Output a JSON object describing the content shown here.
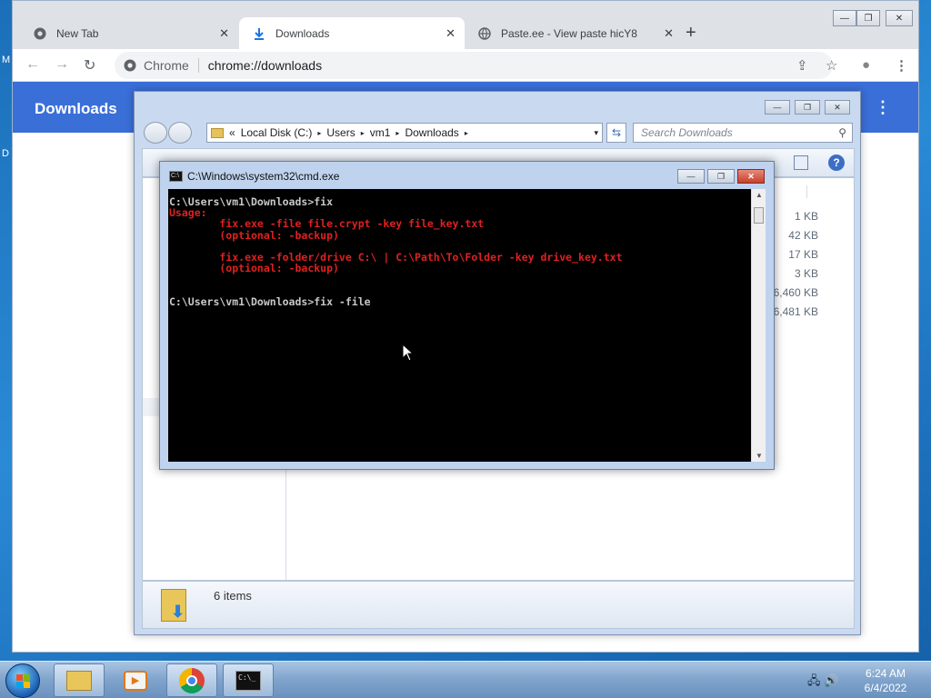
{
  "desktop": {
    "stub_top": "M",
    "stub_mid": "D"
  },
  "chrome": {
    "tabs": [
      {
        "title": "New Tab",
        "icon": "chrome-icon",
        "close": "✕"
      },
      {
        "title": "Downloads",
        "icon": "download-icon",
        "close": "✕"
      },
      {
        "title": "Paste.ee - View paste hicY8",
        "icon": "globe-icon",
        "close": "✕"
      }
    ],
    "new_tab": "+",
    "window_controls": {
      "minimize": "—",
      "restore": "❐",
      "close": "✕"
    },
    "nav": {
      "back": "←",
      "forward": "→",
      "reload": "↻"
    },
    "omnibox": {
      "chip": "Chrome",
      "url": "chrome://downloads"
    },
    "toolbar_icons": {
      "share": "⇪",
      "bookmark": "☆",
      "profile": "●",
      "menu": "⋮"
    },
    "downloads_page": {
      "title": "Downloads",
      "menu": "⋮"
    }
  },
  "explorer": {
    "window_controls": {
      "minimize": "—",
      "restore": "❐",
      "close": "✕"
    },
    "breadcrumb": {
      "prefix": "«",
      "items": [
        "Local Disk (C:)",
        "Users",
        "vm1",
        "Downloads"
      ],
      "sep": "▸",
      "dropdown": "▾"
    },
    "refresh": "⇆",
    "search_placeholder": "Search Downloads",
    "search_icon": "⚲",
    "help": "?",
    "file_sizes": [
      "1 KB",
      "42 KB",
      "17 KB",
      "3 KB",
      "56,460 KB",
      "56,481 KB"
    ],
    "status": {
      "count": "6 items",
      "arrow": "⬇"
    }
  },
  "cmd": {
    "title": "C:\\Windows\\system32\\cmd.exe",
    "icon_text": "C:\\",
    "controls": {
      "minimize": "—",
      "restore": "❐",
      "close": "✕"
    },
    "lines": [
      {
        "text": "C:\\Users\\vm1\\Downloads>fix",
        "color": "w"
      },
      {
        "text": "Usage:",
        "color": "r"
      },
      {
        "text": "        fix.exe -file file.crypt -key file_key.txt",
        "color": "r"
      },
      {
        "text": "        (optional: -backup)",
        "color": "r"
      },
      {
        "text": "",
        "color": "w"
      },
      {
        "text": "        fix.exe -folder/drive C:\\ | C:\\Path\\To\\Folder -key drive_key.txt",
        "color": "r"
      },
      {
        "text": "        (optional: -backup)",
        "color": "r"
      },
      {
        "text": "",
        "color": "w"
      },
      {
        "text": "",
        "color": "w"
      },
      {
        "text": "C:\\Users\\vm1\\Downloads>fix -file",
        "color": "w"
      }
    ],
    "scroll_up": "▲",
    "scroll_down": "▼"
  },
  "taskbar": {
    "buttons": [
      "explorer",
      "media-player",
      "chrome",
      "cmd"
    ],
    "cmd_icon_text": "C:\\_",
    "tray_icons": "🖧 🔊",
    "clock": {
      "time": "6:24 AM",
      "date": "6/4/2022"
    }
  },
  "colors": {
    "console_red": "#e02020",
    "console_white": "#c8c8c8",
    "downloads_blue": "#3a6fd8"
  }
}
